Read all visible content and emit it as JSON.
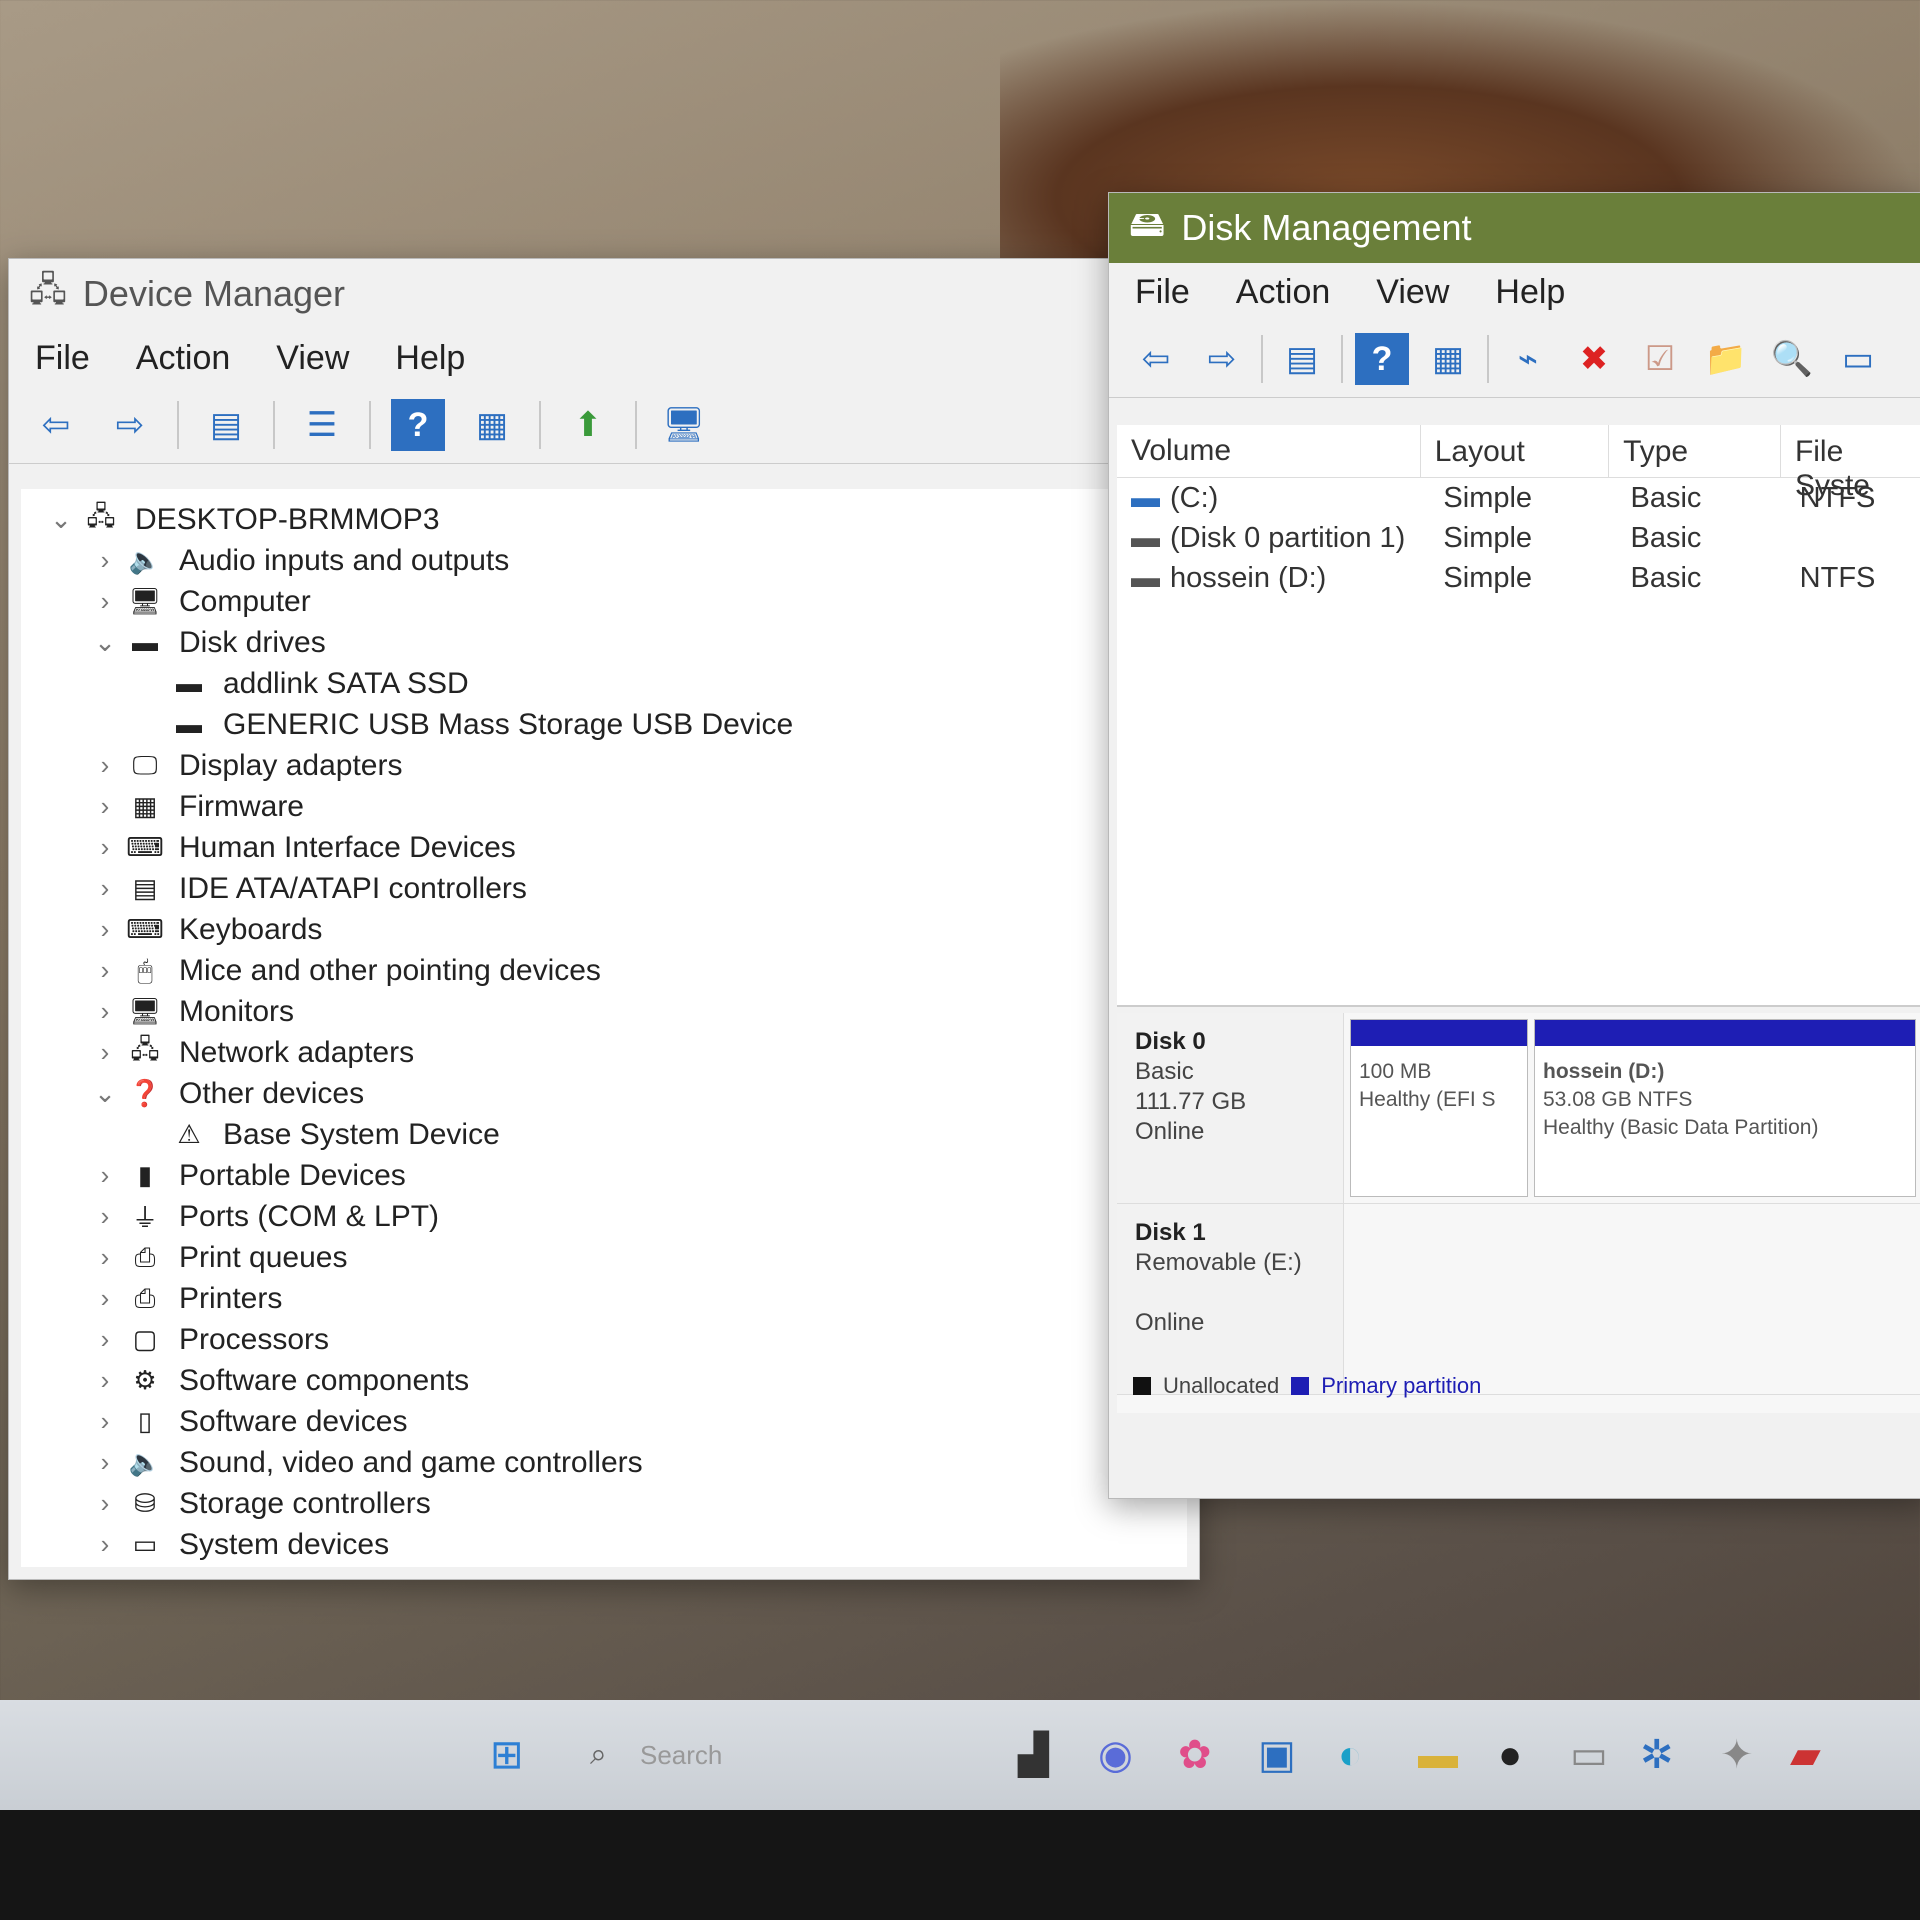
{
  "device_manager": {
    "title": "Device Manager",
    "menu": [
      "File",
      "Action",
      "View",
      "Help"
    ],
    "tree": [
      {
        "label": "DESKTOP-BRMMOP3",
        "level": 0,
        "state": "expanded",
        "icon": "computer-root-icon"
      },
      {
        "label": "Audio inputs and outputs",
        "level": 1,
        "state": "collapsed",
        "icon": "speaker-icon"
      },
      {
        "label": "Computer",
        "level": 1,
        "state": "collapsed",
        "icon": "monitor-icon"
      },
      {
        "label": "Disk drives",
        "level": 1,
        "state": "expanded",
        "icon": "disk-drive-icon"
      },
      {
        "label": "addlink SATA SSD",
        "level": 2,
        "state": "leaf",
        "icon": "disk-drive-icon"
      },
      {
        "label": "GENERIC USB Mass Storage USB Device",
        "level": 2,
        "state": "leaf",
        "icon": "disk-drive-icon"
      },
      {
        "label": "Display adapters",
        "level": 1,
        "state": "collapsed",
        "icon": "display-adapter-icon"
      },
      {
        "label": "Firmware",
        "level": 1,
        "state": "collapsed",
        "icon": "chip-icon"
      },
      {
        "label": "Human Interface Devices",
        "level": 1,
        "state": "collapsed",
        "icon": "hid-icon"
      },
      {
        "label": "IDE ATA/ATAPI controllers",
        "level": 1,
        "state": "collapsed",
        "icon": "controller-icon"
      },
      {
        "label": "Keyboards",
        "level": 1,
        "state": "collapsed",
        "icon": "keyboard-icon"
      },
      {
        "label": "Mice and other pointing devices",
        "level": 1,
        "state": "collapsed",
        "icon": "mouse-icon"
      },
      {
        "label": "Monitors",
        "level": 1,
        "state": "collapsed",
        "icon": "monitor-icon"
      },
      {
        "label": "Network adapters",
        "level": 1,
        "state": "collapsed",
        "icon": "network-icon"
      },
      {
        "label": "Other devices",
        "level": 1,
        "state": "expanded",
        "icon": "unknown-device-icon"
      },
      {
        "label": "Base System Device",
        "level": 2,
        "state": "leaf",
        "icon": "warning-device-icon"
      },
      {
        "label": "Portable Devices",
        "level": 1,
        "state": "collapsed",
        "icon": "portable-device-icon"
      },
      {
        "label": "Ports (COM & LPT)",
        "level": 1,
        "state": "collapsed",
        "icon": "port-icon"
      },
      {
        "label": "Print queues",
        "level": 1,
        "state": "collapsed",
        "icon": "printer-icon"
      },
      {
        "label": "Printers",
        "level": 1,
        "state": "collapsed",
        "icon": "printer-icon"
      },
      {
        "label": "Processors",
        "level": 1,
        "state": "collapsed",
        "icon": "processor-icon"
      },
      {
        "label": "Software components",
        "level": 1,
        "state": "collapsed",
        "icon": "software-component-icon"
      },
      {
        "label": "Software devices",
        "level": 1,
        "state": "collapsed",
        "icon": "software-device-icon"
      },
      {
        "label": "Sound, video and game controllers",
        "level": 1,
        "state": "collapsed",
        "icon": "speaker-icon"
      },
      {
        "label": "Storage controllers",
        "level": 1,
        "state": "collapsed",
        "icon": "storage-controller-icon"
      },
      {
        "label": "System devices",
        "level": 1,
        "state": "collapsed",
        "icon": "system-device-icon"
      }
    ]
  },
  "disk_management": {
    "title": "Disk Management",
    "menu": [
      "File",
      "Action",
      "View",
      "Help"
    ],
    "columns": [
      "Volume",
      "Layout",
      "Type",
      "File Syste"
    ],
    "volumes": [
      {
        "volume": "(C:)",
        "layout": "Simple",
        "type": "Basic",
        "fs": "NTFS"
      },
      {
        "volume": "(Disk 0 partition 1)",
        "layout": "Simple",
        "type": "Basic",
        "fs": ""
      },
      {
        "volume": "hossein (D:)",
        "layout": "Simple",
        "type": "Basic",
        "fs": "NTFS"
      }
    ],
    "disk0": {
      "name": "Disk 0",
      "type": "Basic",
      "size": "111.77 GB",
      "status": "Online",
      "p1_size": "100 MB",
      "p1_status": "Healthy (EFI S",
      "p2_name": "hossein  (D:)",
      "p2_size": "53.08 GB NTFS",
      "p2_status": "Healthy (Basic Data Partition)"
    },
    "disk1": {
      "name": "Disk 1",
      "type": "Removable (E:)",
      "status": "Online"
    },
    "legend": {
      "unallocated": "Unallocated",
      "primary": "Primary partition"
    },
    "colors": {
      "primary": "#1e1eb4",
      "unallocated": "#111111",
      "titlebar": "#6a7f3a"
    }
  },
  "taskbar": {
    "search_placeholder": "Search"
  }
}
